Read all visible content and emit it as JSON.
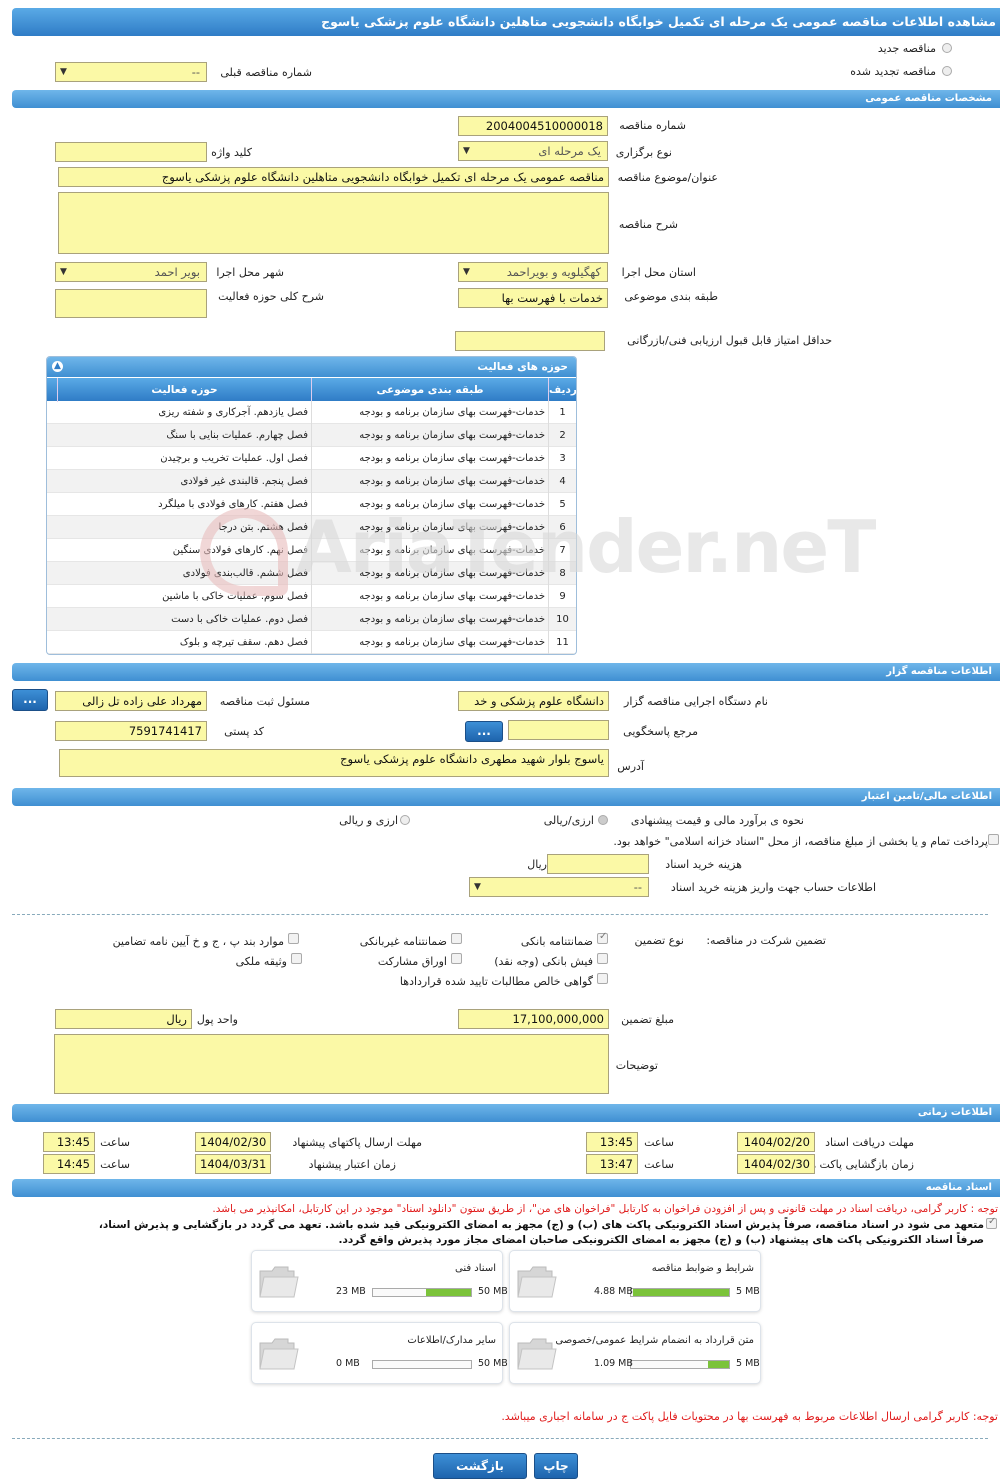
{
  "page_title": "مشاهده اطلاعات مناقصه عمومی یک مرحله ای تکمیل خوابگاه دانشجویی متاهلین دانشگاه علوم پزشکی یاسوج",
  "tender_state": {
    "new_label": "مناقصه جدید",
    "renewed_label": "مناقصه تجدید شده",
    "prev_number_label": "شماره مناقصه قبلی",
    "prev_number_value": "--"
  },
  "general": {
    "section": "مشخصات مناقصه عمومی",
    "number_label": "شماره مناقصه",
    "number_value": "2004004510000018",
    "type_label": "نوع برگزاری",
    "type_value": "یک مرحله ای",
    "keyword_label": "کلید واژه",
    "keyword_value": "",
    "subject_label": "عنوان/موضوع مناقصه",
    "subject_value": "مناقصه عمومی یک مرحله ای تکمیل خوابگاه دانشجویی متاهلین دانشگاه علوم پزشکی یاسوج",
    "desc_label": "شرح مناقصه",
    "desc_value": "",
    "province_label": "استان محل اجرا",
    "province_value": "کهگیلویه و بویراحمد",
    "city_label": "شهر محل اجرا",
    "city_value": "بویر احمد",
    "category_label": "طبقه بندی موضوعی",
    "category_value": "خدمات با فهرست بها",
    "activity_desc_label": "شرح کلی حوزه فعالیت",
    "activity_desc_value": "",
    "min_score_label": "حداقل امتیاز قابل قبول ارزیابی فنی/بازرگانی",
    "min_score_value": ""
  },
  "activity_grid": {
    "title": "حوزه های فعالیت",
    "col_row": "ردیف",
    "col_category": "طبقه بندی موضوعی",
    "col_activity": "حوزه فعالیت",
    "rows": [
      {
        "n": "1",
        "cat": "خدمات-فهرست بهای سازمان برنامه و بودجه",
        "act": "فصل یازدهم. آجرکاری و شفته ریزی"
      },
      {
        "n": "2",
        "cat": "خدمات-فهرست بهای سازمان برنامه و بودجه",
        "act": "فصل چهارم. عملیات بنایی با سنگ"
      },
      {
        "n": "3",
        "cat": "خدمات-فهرست بهای سازمان برنامه و بودجه",
        "act": "فصل اول. عملیات تخریب و برچیدن"
      },
      {
        "n": "4",
        "cat": "خدمات-فهرست بهای سازمان برنامه و بودجه",
        "act": "فصل پنجم. قالبندی غیر فولادی"
      },
      {
        "n": "5",
        "cat": "خدمات-فهرست بهای سازمان برنامه و بودجه",
        "act": "فصل هفتم. کارهای فولادی با میلگرد"
      },
      {
        "n": "6",
        "cat": "خدمات-فهرست بهای سازمان برنامه و بودجه",
        "act": "فصل هشتم. بتن درجا"
      },
      {
        "n": "7",
        "cat": "خدمات-فهرست بهای سازمان برنامه و بودجه",
        "act": "فصل نهم. کارهای فولادی سنگین"
      },
      {
        "n": "8",
        "cat": "خدمات-فهرست بهای سازمان برنامه و بودجه",
        "act": "فصل ششم. قالب‌بندی فولادی"
      },
      {
        "n": "9",
        "cat": "خدمات-فهرست بهای سازمان برنامه و بودجه",
        "act": "فصل سوم. عملیات خاکی با ماشین"
      },
      {
        "n": "10",
        "cat": "خدمات-فهرست بهای سازمان برنامه و بودجه",
        "act": "فصل دوم. عملیات خاکی با دست"
      },
      {
        "n": "11",
        "cat": "خدمات-فهرست بهای سازمان برنامه و بودجه",
        "act": "فصل دهم. سقف تیرچه و بلوک"
      }
    ]
  },
  "organizer": {
    "section": "اطلاعات مناقصه گزار",
    "org_label": "نام دستگاه اجرایی مناقصه گزار",
    "org_value": "دانشگاه علوم پزشکی و خد",
    "registrar_label": "مسئول ثبت مناقصه",
    "registrar_value": "مهرداد علی زاده تل زالی",
    "registrar_btn": "...",
    "reference_label": "مرجع پاسخگویی",
    "reference_value": "",
    "reference_btn": "...",
    "postal_label": "کد پستی",
    "postal_value": "7591741417",
    "address_label": "آدرس",
    "address_value": "یاسوج بلوار شهید مطهری دانشگاه علوم پزشکی یاسوج"
  },
  "finance": {
    "section": "اطلاعات مالی/تامین اعتبار",
    "method_label": "نحوه ی برآورد مالی و قیمت پیشنهادی",
    "opt1": "ارزی/ریالی",
    "opt2": "ارزی و ریالی",
    "treasury_text": "پرداخت تمام و یا بخشی از مبلغ مناقصه، از محل \"اسناد خزانه اسلامی\" خواهد بود.",
    "fee_label": "هزینه خرید اسناد",
    "fee_value": "",
    "fee_unit": "ریال",
    "account_label": "اطلاعات حساب جهت واریز هزینه خرید اسناد",
    "account_value": "--"
  },
  "guarantee": {
    "label": "تضمین شرکت در مناقصه:",
    "type_label": "نوع تضمین",
    "opt_bank": "ضمانتنامه بانکی",
    "opt_nonbank": "ضمانتنامه غیربانکی",
    "opt_article": "موارد بند پ ، ج و خ آیین نامه تضامین",
    "opt_receipt": "فیش بانکی (وجه نقد)",
    "opt_bonds": "اوراق مشارکت",
    "opt_property": "وثیقه ملکی",
    "opt_claims": "گواهی خالص مطالبات تایید شده قراردادها",
    "amount_label": "مبلغ تضمین",
    "amount_value": "17,100,000,000",
    "currency_label": "واحد پول",
    "currency_value": "ریال",
    "notes_label": "توضیحات",
    "notes_value": ""
  },
  "timing": {
    "section": "اطلاعات زمانی",
    "doc_receive_label": "مهلت دریافت اسناد",
    "doc_receive_date": "1404/02/20",
    "doc_receive_time": "13:45",
    "send_label": "مهلت ارسال پاکتهای پیشنهاد",
    "send_date": "1404/02/30",
    "send_time": "13:45",
    "open_label": "زمان بازگشایی پاکت ها",
    "open_date": "1404/02/30",
    "open_time": "13:47",
    "valid_label": "زمان اعتبار پیشنهاد",
    "valid_date": "1404/03/31",
    "valid_time": "14:45",
    "time_label": "ساعت"
  },
  "docs": {
    "section": "اسناد مناقصه",
    "note_red": "توجه : کاربر گرامی، دریافت اسناد در مهلت قانونی و پس از افزودن فراخوان به کارتابل \"فراخوان های من\"، از طریق ستون \"دانلود اسناد\" موجود در این کارتابل، امکانپذیر می باشد.",
    "commit_line1": "متعهد می شود در اسناد مناقصه، صرفاً پذیرش اسناد الکترونیکی پاکت های (ب) و (ج) مجهز به امضای الکترونیکی قید شده باشد. تعهد می گردد در بازگشایی و پذیرش اسناد،",
    "commit_line2": "صرفاً اسناد الکترونیکی پاکت های پیشنهاد (ب) و (ج) مجهز به امضای الکترونیکی صاحبان امضای مجاز مورد پذیرش واقع گردد.",
    "items": [
      {
        "title": "شرایط و ضوابط مناقصه",
        "current": "4.88 MB",
        "max": "5 MB",
        "ratio": 0.976
      },
      {
        "title": "اسناد فنی",
        "current": "23 MB",
        "max": "50 MB",
        "ratio": 0.46
      },
      {
        "title": "متن قرارداد به انضمام شرایط عمومی/خصوصی",
        "current": "1.09 MB",
        "max": "5 MB",
        "ratio": 0.218
      },
      {
        "title": "سایر مدارک/اطلاعات",
        "current": "0 MB",
        "max": "50 MB",
        "ratio": 0
      }
    ],
    "note_bottom": "توجه: کاربر گرامی ارسال اطلاعات مربوط به فهرست بها در محتویات فایل پاکت ج در سامانه اجباری میباشد."
  },
  "actions": {
    "print": "چاپ",
    "back": "بازگشت"
  },
  "watermark": "AriaTender.neT"
}
